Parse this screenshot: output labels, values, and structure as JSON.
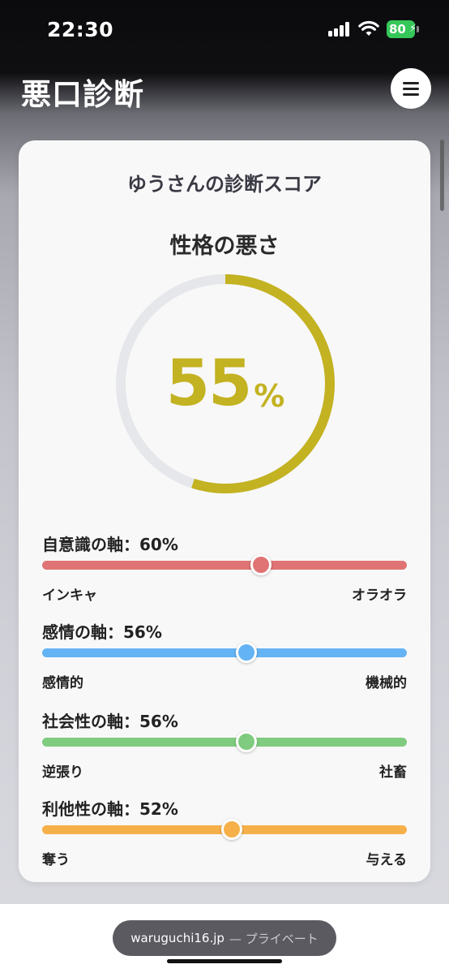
{
  "status_bar": {
    "time": "22:30",
    "battery": "80"
  },
  "header": {
    "title": "悪口診断"
  },
  "card": {
    "title": "ゆうさんの診断スコア",
    "gauge": {
      "title": "性格の悪さ",
      "value": 55,
      "value_text": "55",
      "unit": "%",
      "color": "#c3b221",
      "track_color": "#e6e7ea"
    },
    "axes": [
      {
        "label": "自意識の軸：60%",
        "value": 60,
        "left": "インキャ",
        "right": "オラオラ",
        "color": "#e07474"
      },
      {
        "label": "感情の軸：56%",
        "value": 56,
        "left": "感情的",
        "right": "機械的",
        "color": "#64b3f4"
      },
      {
        "label": "社会性の軸：56%",
        "value": 56,
        "left": "逆張り",
        "right": "社畜",
        "color": "#7fcb7f"
      },
      {
        "label": "利他性の軸：52%",
        "value": 52,
        "left": "奪う",
        "right": "与える",
        "color": "#f6b04a"
      }
    ]
  },
  "browser": {
    "url": "waruguchi16.jp",
    "mode": "— プライベート"
  }
}
